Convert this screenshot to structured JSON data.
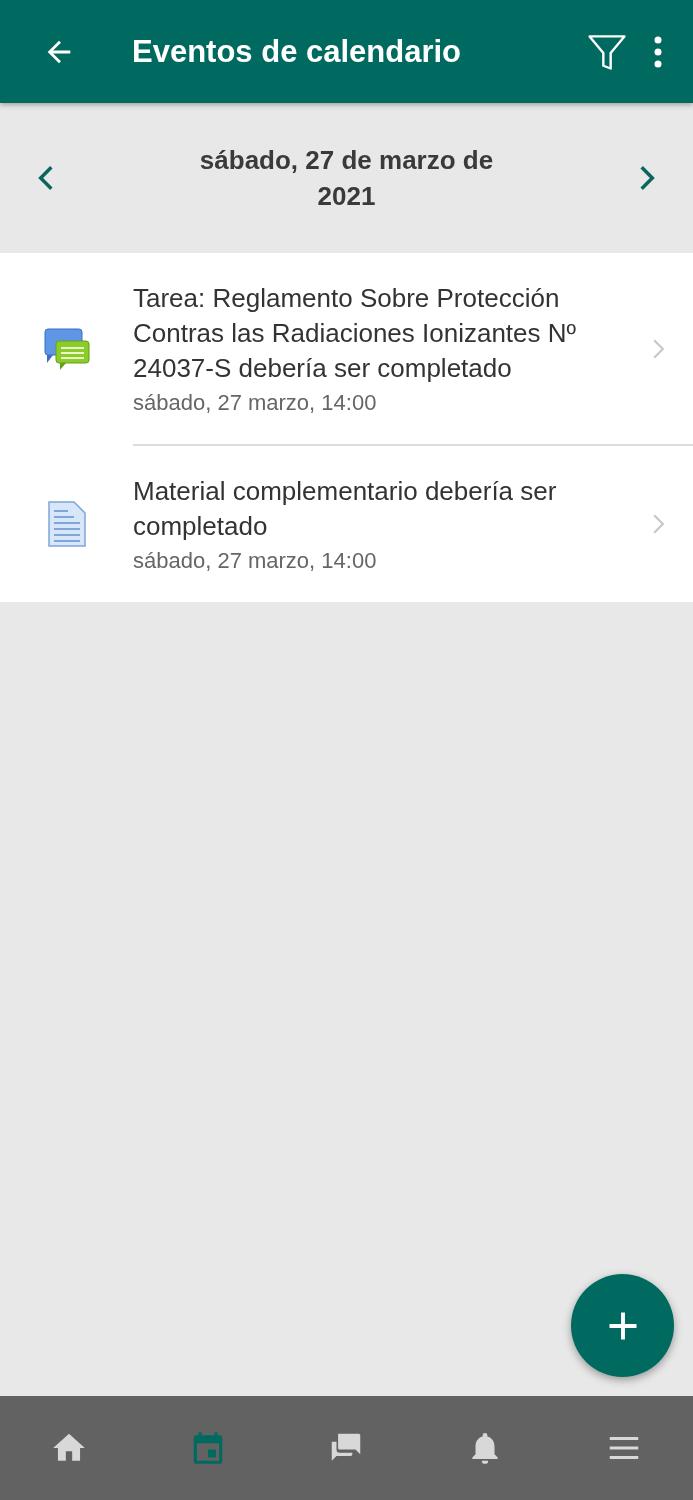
{
  "header": {
    "title": "Eventos de calendario"
  },
  "date_nav": {
    "date": "sábado, 27 de marzo de 2021"
  },
  "events": [
    {
      "kind": "forum",
      "title": "Tarea: Reglamento Sobre Protección Contras las Radiaciones Ionizantes Nº 24037-S debería ser completado",
      "time": "sábado, 27 marzo, 14:00"
    },
    {
      "kind": "resource",
      "title": "Material complementario debería ser completado",
      "time": "sábado, 27 marzo, 14:00"
    }
  ],
  "tabs": [
    {
      "kind": "home",
      "selected": false
    },
    {
      "kind": "calendar",
      "selected": true
    },
    {
      "kind": "messages",
      "selected": false
    },
    {
      "kind": "notifications",
      "selected": false
    },
    {
      "kind": "menu",
      "selected": false
    }
  ]
}
